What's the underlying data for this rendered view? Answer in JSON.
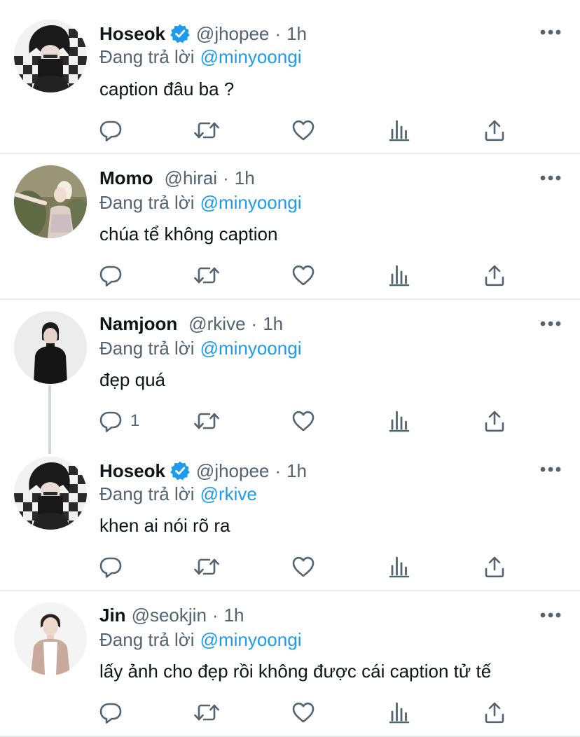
{
  "tweets": [
    {
      "name": "Hoseok",
      "verified": true,
      "handle": "@jhopee",
      "separator": "·",
      "time": "1h",
      "reply_prefix": "Đang trả lời",
      "reply_to": "@minyoongi",
      "text": "caption đâu ba ?",
      "reply_count": ""
    },
    {
      "name": "Momo",
      "verified": false,
      "handle": "@hirai",
      "separator": "·",
      "time": "1h",
      "reply_prefix": "Đang trả lời",
      "reply_to": "@minyoongi",
      "text": "chúa tể không caption",
      "reply_count": ""
    },
    {
      "name": "Namjoon",
      "verified": false,
      "handle": "@rkive",
      "separator": "·",
      "time": "1h",
      "reply_prefix": "Đang trả lời",
      "reply_to": "@minyoongi",
      "text": "đẹp quá",
      "reply_count": "1"
    },
    {
      "name": "Hoseok",
      "verified": true,
      "handle": "@jhopee",
      "separator": "·",
      "time": "1h",
      "reply_prefix": "Đang trả lời",
      "reply_to": "@rkive",
      "text": "khen ai nói rõ ra",
      "reply_count": ""
    },
    {
      "name": "Jin",
      "verified": false,
      "handle": "@seokjin",
      "separator": "·",
      "time": "1h",
      "reply_prefix": "Đang trả lời",
      "reply_to": "@minyoongi",
      "text": "lấy ảnh cho đẹp rồi không được cái caption tử tế",
      "reply_count": ""
    }
  ],
  "colors": {
    "accent": "#1d9bf0",
    "secondary_text": "#536471",
    "icon": "#536471",
    "divider": "#e6ecf0"
  },
  "icons": {
    "reply": "reply-icon",
    "retweet": "retweet-icon",
    "like": "heart-icon",
    "analytics": "analytics-icon",
    "share": "share-icon",
    "more": "more-icon",
    "verified": "verified-badge-icon"
  }
}
